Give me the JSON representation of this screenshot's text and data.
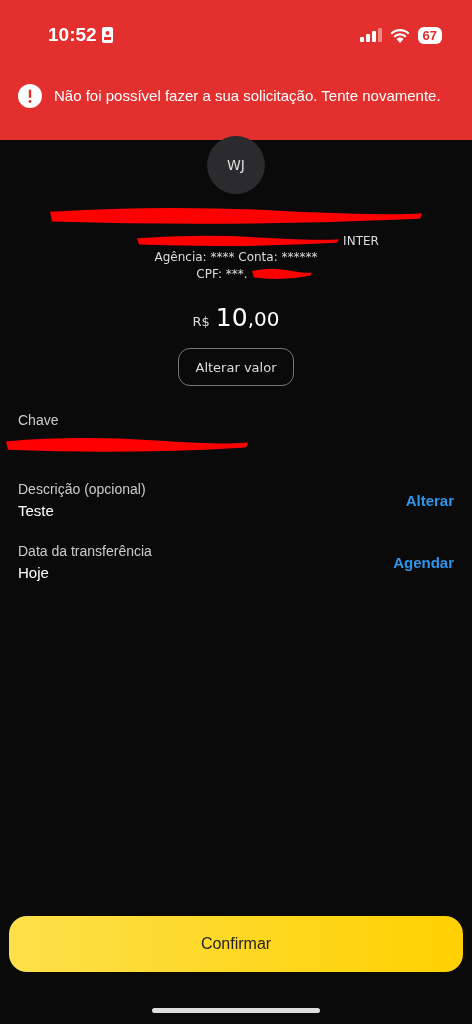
{
  "status_bar": {
    "time": "10:52",
    "battery": "67"
  },
  "error_banner": {
    "message": "Não foi possível fazer a sua solicitação. Tente novamente."
  },
  "recipient": {
    "initials": "WJ",
    "bank_visible": "INTER",
    "branch_account": "Agência: **** Conta: ******",
    "cpf_visible": "CPF: ***."
  },
  "amount": {
    "currency": "R$",
    "integer": "10",
    "cents": ",00"
  },
  "change_amount_button": "Alterar valor",
  "fields": [
    {
      "kind": "redacted",
      "label": "Chave"
    },
    {
      "kind": "value",
      "label": "Descrição (opcional)",
      "value": "Teste",
      "action": "Alterar"
    },
    {
      "kind": "value",
      "label": "Data da transferência",
      "value": "Hoje",
      "action": "Agendar"
    }
  ],
  "confirm_button": "Confirmar"
}
